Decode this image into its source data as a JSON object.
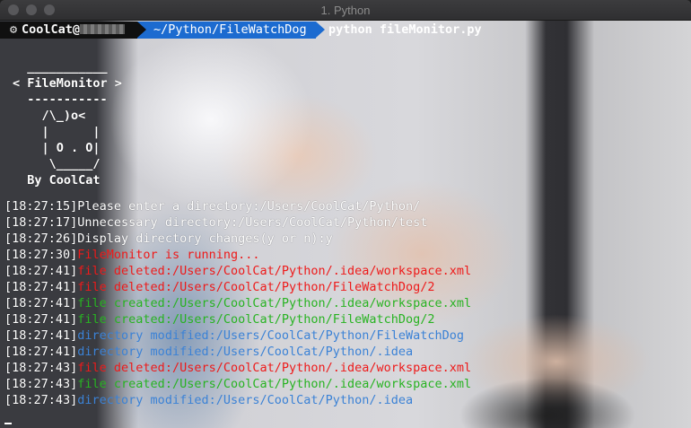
{
  "window": {
    "title": "1. Python",
    "colors": {
      "titlebar": "#353537",
      "traffic_light": "#58585b"
    }
  },
  "prompt": {
    "user": "CoolCat@",
    "path": "~/Python/FileWatchDog",
    "command": "python fileMonitor.py",
    "user_icon": "gear-icon",
    "colors": {
      "user_bg": "#101010",
      "path_bg": "#1c6bd0"
    }
  },
  "banner": {
    "lines": [
      "  ___________",
      "< FileMonitor >",
      "  -----------",
      "    /\\_)o<",
      "    |      |",
      "    | O . O|",
      "     \\_____/",
      "  By CoolCat"
    ]
  },
  "log": [
    {
      "time": "[18:27:15]",
      "message": "Please enter a directory:/Users/CoolCat/Python/",
      "color": "white"
    },
    {
      "time": "[18:27:17]",
      "message": "Unnecessary directory:/Users/CoolCat/Python/test",
      "color": "white"
    },
    {
      "time": "[18:27:26]",
      "message": "Display directory changes(y or n):y",
      "color": "white"
    },
    {
      "time": "[18:27:30]",
      "message": "FileMonitor is running...",
      "color": "red"
    },
    {
      "time": "[18:27:41]",
      "message": "file deleted:/Users/CoolCat/Python/.idea/workspace.xml",
      "color": "red"
    },
    {
      "time": "[18:27:41]",
      "message": "file deleted:/Users/CoolCat/Python/FileWatchDog/2",
      "color": "red"
    },
    {
      "time": "[18:27:41]",
      "message": "file created:/Users/CoolCat/Python/.idea/workspace.xml",
      "color": "green"
    },
    {
      "time": "[18:27:41]",
      "message": "file created:/Users/CoolCat/Python/FileWatchDog/2",
      "color": "green"
    },
    {
      "time": "[18:27:41]",
      "message": "directory modified:/Users/CoolCat/Python/FileWatchDog",
      "color": "blue"
    },
    {
      "time": "[18:27:41]",
      "message": "directory modified:/Users/CoolCat/Python/.idea",
      "color": "blue"
    },
    {
      "time": "[18:27:43]",
      "message": "file deleted:/Users/CoolCat/Python/.idea/workspace.xml",
      "color": "red"
    },
    {
      "time": "[18:27:43]",
      "message": "file created:/Users/CoolCat/Python/.idea/workspace.xml",
      "color": "green"
    },
    {
      "time": "[18:27:43]",
      "message": "directory modified:/Users/CoolCat/Python/.idea",
      "color": "blue"
    }
  ],
  "palette": {
    "white": "#ffffff",
    "red": "#ee1a1a",
    "green": "#28b322",
    "blue": "#3b82d6"
  }
}
